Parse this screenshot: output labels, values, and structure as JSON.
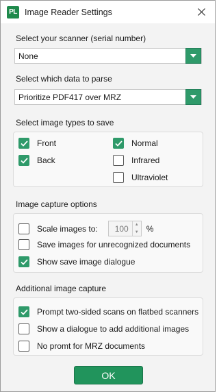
{
  "window": {
    "logo_text": "PL",
    "title": "Image Reader Settings"
  },
  "scanner": {
    "label": "Select your scanner (serial number)",
    "value": "None"
  },
  "parse": {
    "label": "Select which data to parse",
    "value": "Prioritize PDF417 over MRZ"
  },
  "image_types": {
    "label": "Select image types to save",
    "front": {
      "label": "Front",
      "checked": true
    },
    "back": {
      "label": "Back",
      "checked": true
    },
    "normal": {
      "label": "Normal",
      "checked": true
    },
    "infrared": {
      "label": "Infrared",
      "checked": false
    },
    "ultraviolet": {
      "label": "Ultraviolet",
      "checked": false
    }
  },
  "capture": {
    "label": "Image capture options",
    "scale": {
      "label": "Scale images to:",
      "checked": false,
      "value": "100",
      "unit": "%"
    },
    "unrecognized": {
      "label": "Save images for unrecognized documents",
      "checked": false
    },
    "dialogue": {
      "label": "Show save image dialogue",
      "checked": true
    }
  },
  "additional": {
    "label": "Additional image capture",
    "two_sided": {
      "label": "Prompt two-sided scans on flatbed scanners",
      "checked": true
    },
    "add_dialog": {
      "label": "Show a dialogue to add additional images",
      "checked": false
    },
    "no_prompt_mrz": {
      "label": "No promt for MRZ documents",
      "checked": false
    }
  },
  "ok_label": "OK",
  "colors": {
    "accent": "#2f9a6a",
    "ok_button": "#21945c",
    "logo": "#1f8a4c"
  }
}
